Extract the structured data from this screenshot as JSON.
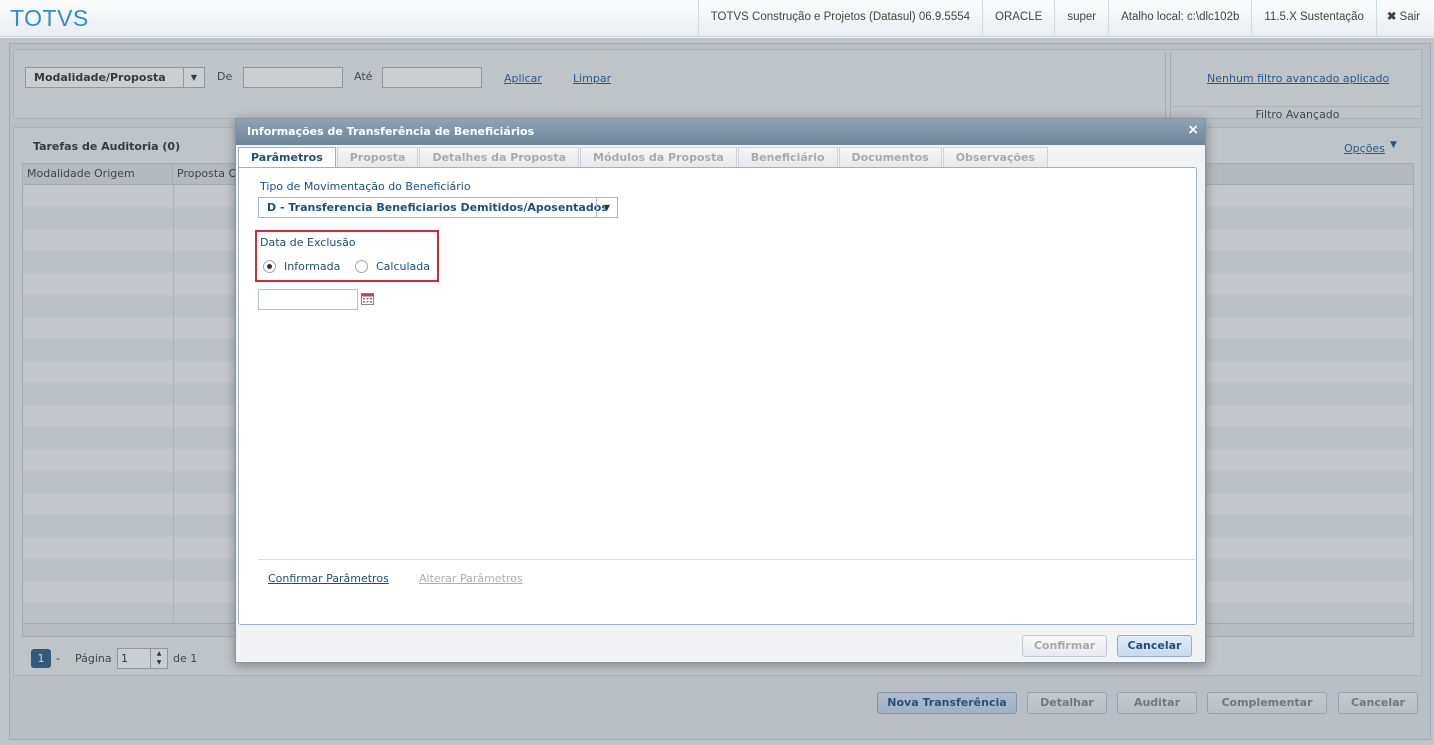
{
  "topbar": {
    "logo": "TOTVS",
    "product": "TOTVS Construção e Projetos (Datasul) 06.9.5554",
    "database": "ORACLE",
    "user": "super",
    "shortcut": "Atalho local: c:\\dlc102b",
    "version": "11.5.X Sustentação",
    "exit_label": "Sair"
  },
  "filters": {
    "modality_select": "Modalidade/Proposta",
    "from_label": "De",
    "to_label": "Até",
    "apply_link": "Aplicar",
    "clear_link": "Limpar",
    "advanced_link": "Nenhum filtro avancado aplicado",
    "advanced_title": "Filtro Avançado"
  },
  "grid": {
    "title": "Tarefas de Auditoria (0)",
    "options_link": "Opções",
    "columns": [
      "Modalidade Origem",
      "Proposta O"
    ]
  },
  "pagination": {
    "current": "1",
    "dash": "-",
    "page_label": "Página",
    "page_value": "1",
    "of_label": "de 1"
  },
  "footer_buttons": {
    "new_transfer": "Nova Transferência",
    "detail": "Detalhar",
    "audit": "Auditar",
    "complement": "Complementar",
    "cancel": "Cancelar"
  },
  "modal": {
    "title": "Informações de Transferência de Beneficiários",
    "tabs": [
      "Parâmetros",
      "Proposta",
      "Detalhes da Proposta",
      "Módulos da Proposta",
      "Beneficiário",
      "Documentos",
      "Observações"
    ],
    "movement_type_label": "Tipo de Movimentação do Beneficiário",
    "movement_type_value": "D - Transferencia Beneficiarios Demitidos/Aposentados",
    "exclusion_date_label": "Data de Exclusão",
    "radio_informada": "Informada",
    "radio_calculada": "Calculada",
    "confirm_params_link": "Confirmar Parâmetros",
    "change_params_link": "Alterar Parâmetros",
    "confirm_button": "Confirmar",
    "cancel_button": "Cancelar"
  },
  "colors": {
    "accent": "#1e4f80",
    "highlight": "#d9262f",
    "logo": "#2a8fd4"
  }
}
